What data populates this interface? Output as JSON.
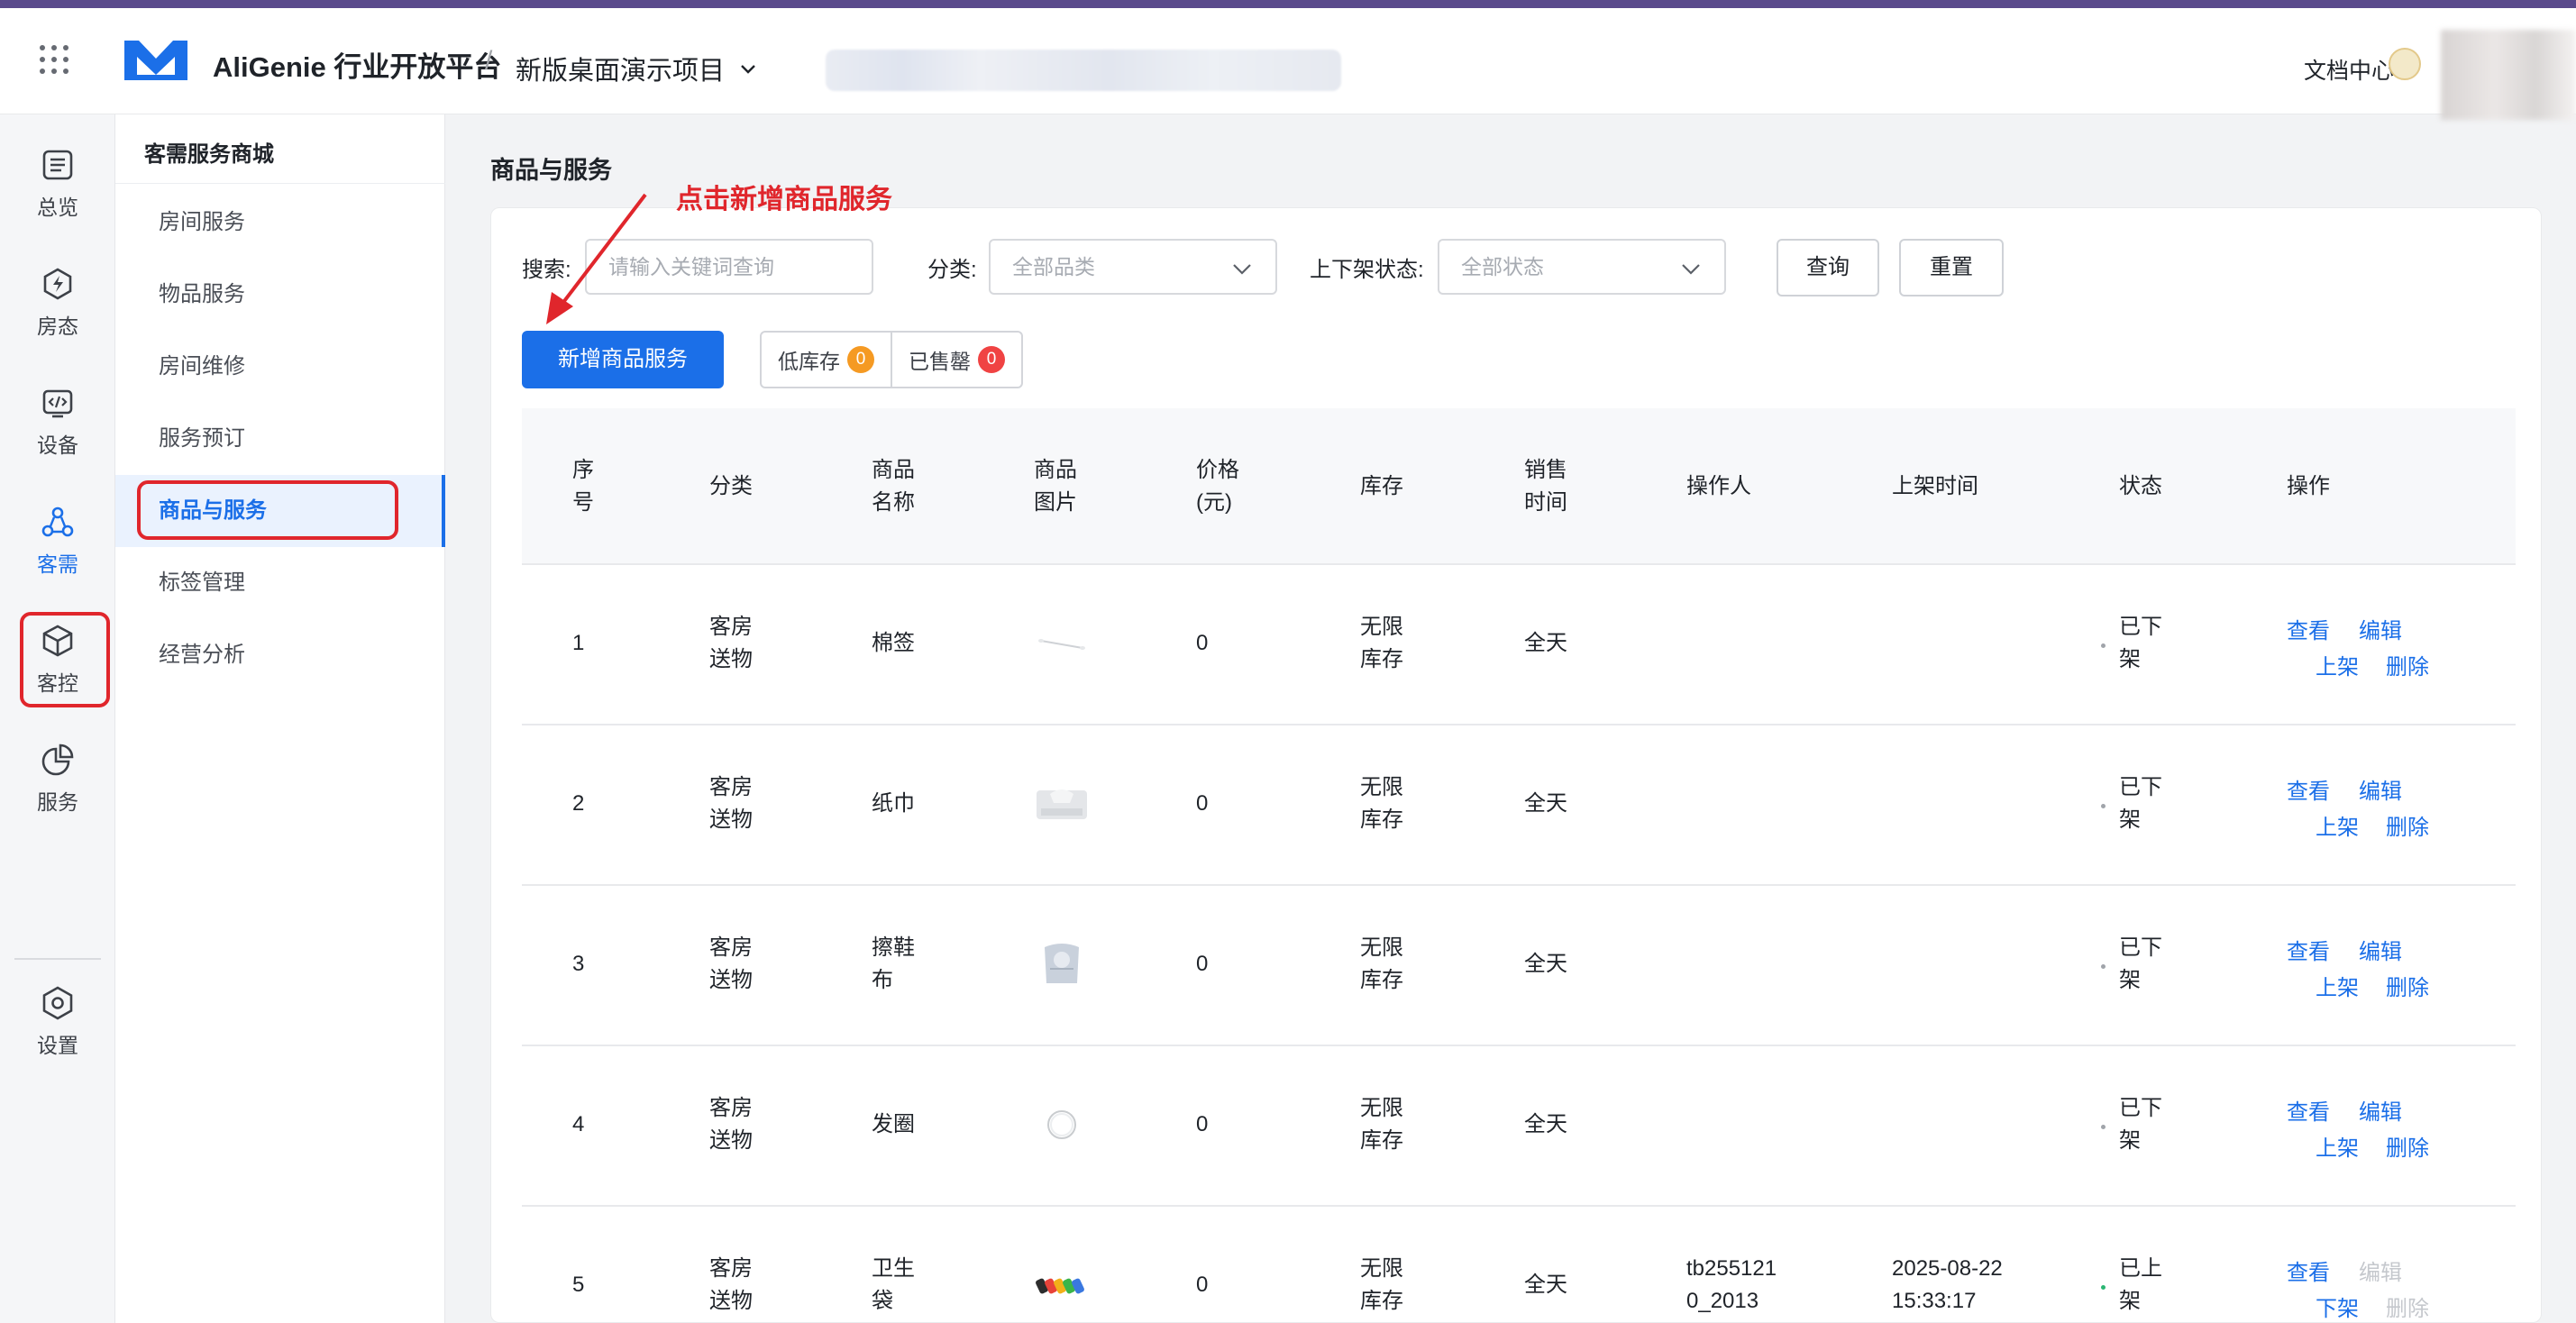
{
  "header": {
    "brand": "AliGenie 行业开放平台",
    "separator": "/",
    "project": "新版桌面演示项目",
    "doc_link": "文档中心"
  },
  "rail": {
    "items": [
      {
        "label": "总览",
        "icon": "list-icon"
      },
      {
        "label": "房态",
        "icon": "lightning-icon"
      },
      {
        "label": "设备",
        "icon": "code-icon"
      },
      {
        "label": "客需",
        "icon": "nodes-icon",
        "active": true
      },
      {
        "label": "客控",
        "icon": "cube-icon"
      },
      {
        "label": "服务",
        "icon": "pie-icon"
      },
      {
        "label": "设置",
        "icon": "hexagon-gear-icon"
      }
    ]
  },
  "subnav": {
    "title": "客需服务商城",
    "items": [
      "房间服务",
      "物品服务",
      "房间维修",
      "服务预订",
      "商品与服务",
      "标签管理",
      "经营分析"
    ],
    "active_index": 4
  },
  "page": {
    "title": "商品与服务",
    "annotation": "点击新增商品服务"
  },
  "filters": {
    "search_label": "搜索:",
    "search_placeholder": "请输入关键词查询",
    "category_label": "分类:",
    "category_value": "全部品类",
    "status_label": "上下架状态:",
    "status_value": "全部状态",
    "query_button": "查询",
    "reset_button": "重置"
  },
  "actions": {
    "add_button": "新增商品服务",
    "low_stock_label": "低库存",
    "low_stock_count": "0",
    "sold_out_label": "已售罄",
    "sold_out_count": "0"
  },
  "colors": {
    "primary": "#1b6fe8",
    "annotation_red": "#e0262c",
    "low_stock_badge": "#f59a23",
    "sold_out_badge": "#f04343",
    "online_dot": "#2bb673",
    "offline_dot": "#a0a4aa"
  },
  "table": {
    "headers": {
      "seq": [
        "序",
        "号"
      ],
      "category": "分类",
      "name": [
        "商品",
        "名称"
      ],
      "image": [
        "商品",
        "图片"
      ],
      "price": [
        "价格",
        "(元)"
      ],
      "stock": "库存",
      "sale_time": [
        "销售",
        "时间"
      ],
      "operator": "操作人",
      "list_time": "上架时间",
      "status": "状态",
      "ops": "操作"
    },
    "rows": [
      {
        "seq": "1",
        "category": [
          "客房",
          "送物"
        ],
        "name": [
          "棉签"
        ],
        "image": "cotton-swab-thumb",
        "price": "0",
        "stock": [
          "无限",
          "库存"
        ],
        "sale_time": "全天",
        "operator": [
          "",
          ""
        ],
        "list_time": [
          "",
          ""
        ],
        "status": [
          "已下",
          "架"
        ],
        "online": false,
        "ops": [
          "查看",
          "编辑",
          "上架",
          "删除"
        ],
        "disabled": [
          false,
          false,
          false,
          false
        ]
      },
      {
        "seq": "2",
        "category": [
          "客房",
          "送物"
        ],
        "name": [
          "纸巾"
        ],
        "image": "tissue-thumb",
        "price": "0",
        "stock": [
          "无限",
          "库存"
        ],
        "sale_time": "全天",
        "operator": [
          "",
          ""
        ],
        "list_time": [
          "",
          ""
        ],
        "status": [
          "已下",
          "架"
        ],
        "online": false,
        "ops": [
          "查看",
          "编辑",
          "上架",
          "删除"
        ],
        "disabled": [
          false,
          false,
          false,
          false
        ]
      },
      {
        "seq": "3",
        "category": [
          "客房",
          "送物"
        ],
        "name": [
          "擦鞋",
          "布"
        ],
        "image": "shoe-cloth-thumb",
        "price": "0",
        "stock": [
          "无限",
          "库存"
        ],
        "sale_time": "全天",
        "operator": [
          "",
          ""
        ],
        "list_time": [
          "",
          ""
        ],
        "status": [
          "已下",
          "架"
        ],
        "online": false,
        "ops": [
          "查看",
          "编辑",
          "上架",
          "删除"
        ],
        "disabled": [
          false,
          false,
          false,
          false
        ]
      },
      {
        "seq": "4",
        "category": [
          "客房",
          "送物"
        ],
        "name": [
          "发圈"
        ],
        "image": "hair-tie-thumb",
        "price": "0",
        "stock": [
          "无限",
          "库存"
        ],
        "sale_time": "全天",
        "operator": [
          "",
          ""
        ],
        "list_time": [
          "",
          ""
        ],
        "status": [
          "已下",
          "架"
        ],
        "online": false,
        "ops": [
          "查看",
          "编辑",
          "上架",
          "删除"
        ],
        "disabled": [
          false,
          false,
          false,
          false
        ]
      },
      {
        "seq": "5",
        "category": [
          "客房",
          "送物"
        ],
        "name": [
          "卫生",
          "袋"
        ],
        "image": "sanitary-bag-thumb",
        "price": "0",
        "stock": [
          "无限",
          "库存"
        ],
        "sale_time": "全天",
        "operator": [
          "tb255121",
          "0_2013"
        ],
        "list_time": [
          "2025-08-22",
          "15:33:17"
        ],
        "status": [
          "已上",
          "架"
        ],
        "online": true,
        "ops": [
          "查看",
          "编辑",
          "下架",
          "删除"
        ],
        "disabled": [
          false,
          true,
          false,
          true
        ]
      }
    ]
  }
}
